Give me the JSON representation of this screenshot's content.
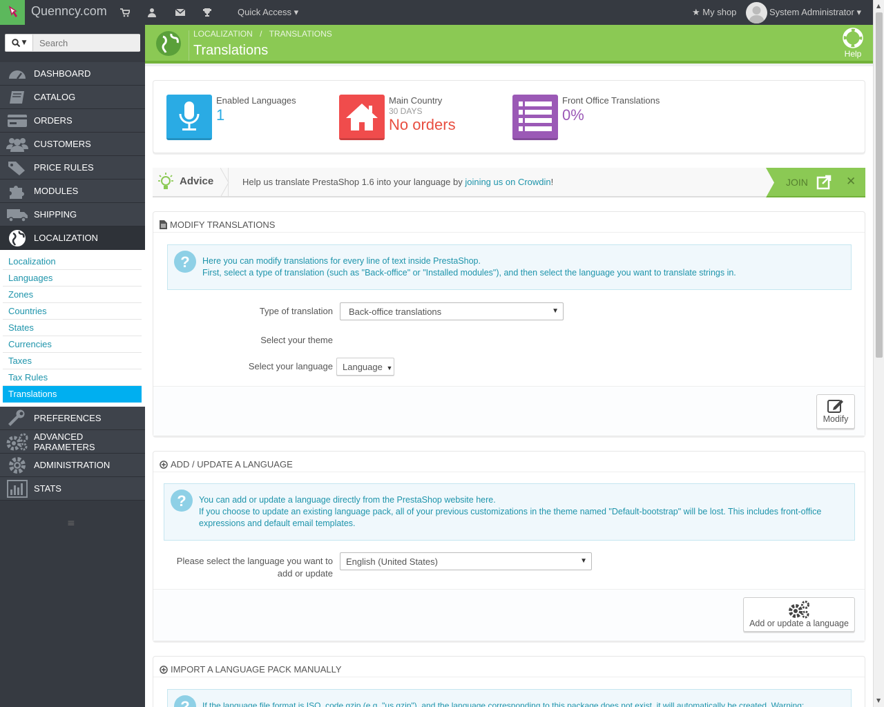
{
  "topbar": {
    "shop_name": "Quenncy.com",
    "quick_access": "Quick Access",
    "my_shop": "My shop",
    "user_name": "System Administrator"
  },
  "sidebar": {
    "search_placeholder": "Search",
    "menu": [
      {
        "label": "DASHBOARD",
        "icon": "dashboard-icon"
      },
      {
        "label": "CATALOG",
        "icon": "book-icon"
      },
      {
        "label": "ORDERS",
        "icon": "credit-card-icon"
      },
      {
        "label": "CUSTOMERS",
        "icon": "users-icon"
      },
      {
        "label": "PRICE RULES",
        "icon": "tags-icon"
      },
      {
        "label": "MODULES",
        "icon": "puzzle-icon"
      },
      {
        "label": "SHIPPING",
        "icon": "truck-icon"
      },
      {
        "label": "LOCALIZATION",
        "icon": "globe-icon"
      }
    ],
    "submenu": [
      "Localization",
      "Languages",
      "Zones",
      "Countries",
      "States",
      "Currencies",
      "Taxes",
      "Tax Rules",
      "Translations"
    ],
    "menu_after": [
      {
        "label": "PREFERENCES",
        "icon": "wrench-icon"
      },
      {
        "label": "ADVANCED PARAMETERS",
        "icon": "cogs-icon"
      },
      {
        "label": "ADMINISTRATION",
        "icon": "gear-icon"
      },
      {
        "label": "STATS",
        "icon": "bar-chart-icon"
      }
    ]
  },
  "header": {
    "breadcrumb_1": "LOCALIZATION",
    "breadcrumb_sep": "/",
    "breadcrumb_2": "TRANSLATIONS",
    "title": "Translations",
    "help": "Help"
  },
  "kpis": [
    {
      "title": "Enabled Languages",
      "subtitle": "",
      "value": "1",
      "color": "#2aabe4"
    },
    {
      "title": "Main Country",
      "subtitle": "30 DAYS",
      "value": "No orders",
      "color": "#f04c4c"
    },
    {
      "title": "Front Office Translations",
      "subtitle": "",
      "value": "0%",
      "color": "#9b59b6"
    }
  ],
  "advice": {
    "label": "Advice",
    "message": "Help us translate PrestaShop 1.6 into your language by ",
    "link": "joining us on Crowdin",
    "message_end": "!",
    "join": "JOIN"
  },
  "modify": {
    "heading": "MODIFY TRANSLATIONS",
    "info_line1": "Here you can modify translations for every line of text inside PrestaShop.",
    "info_line2": "First, select a type of translation (such as \"Back-office\" or \"Installed modules\"), and then select the language you want to translate strings in.",
    "type_label": "Type of translation",
    "type_value": "Back-office translations",
    "theme_label": "Select your theme",
    "language_label": "Select your language",
    "language_button": "Language",
    "modify_button": "Modify"
  },
  "add_update": {
    "heading": "ADD / UPDATE A LANGUAGE",
    "info_line1": "You can add or update a language directly from the PrestaShop website here.",
    "info_line2": "If you choose to update an existing language pack, all of your previous customizations in the theme named \"Default-bootstrap\" will be lost. This includes front-office",
    "info_line3": "expressions and default email templates.",
    "select_label_1": "Please select the language you want to",
    "select_label_2": "add or update",
    "select_value": "English (United States)",
    "button": "Add or update a language"
  },
  "import": {
    "heading": "IMPORT A LANGUAGE PACK MANUALLY",
    "info_line1": "If the language file format is ISO_code.gzip (e.g. \"us.gzip\"), and the language corresponding to this package does not exist, it will automatically be created. Warning:"
  }
}
